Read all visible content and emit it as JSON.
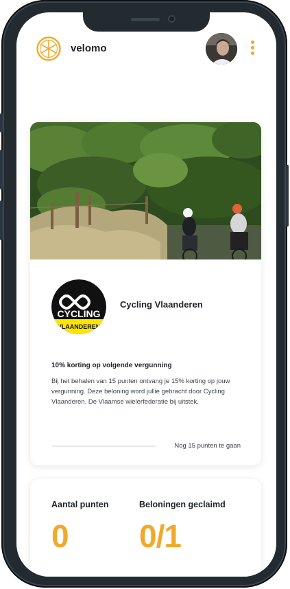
{
  "app": {
    "name": "velomo",
    "logo_icon": "orange-slice-icon",
    "menu_icon": "more-vertical-icon",
    "accent_color": "#f0a92c"
  },
  "reward_card": {
    "sponsor_name": "Cycling Vlaanderen",
    "sponsor_logo_text": {
      "line1": "CYCLING",
      "line2": "VLAANDEREN"
    },
    "reward_title": "10% korting op volgende vergunning",
    "reward_description": "Bij het behalen van 15 punten ontvang je 15% korting op jouw vergunning. Deze beloning word jullie gebracht door Cycling Vlaanderen. De Vlaamse wielerfederatie bij uitstek.",
    "progress_fraction": 0,
    "progress_text": "Nog 15 punten te gaan"
  },
  "stats": {
    "points_label": "Aantal punten",
    "points_value": "0",
    "rewards_label": "Beloningen geclaimd",
    "rewards_value": "0/1"
  }
}
